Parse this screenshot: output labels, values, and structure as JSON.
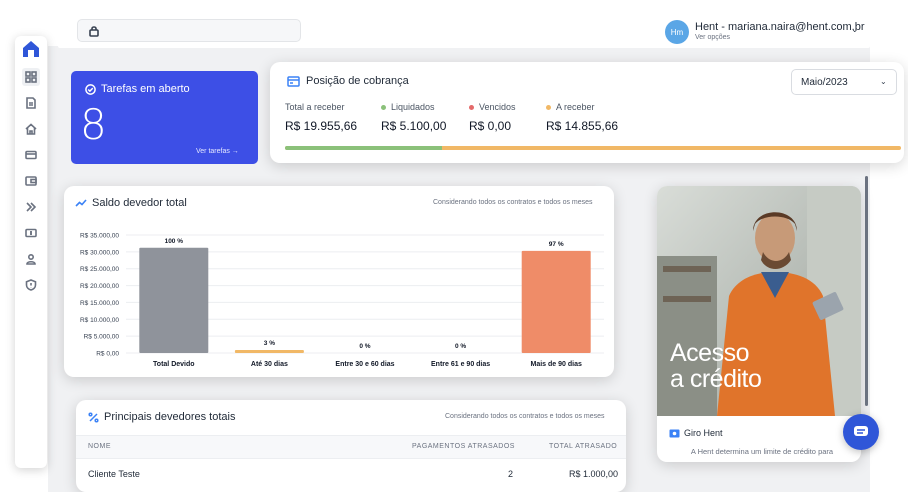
{
  "header": {
    "search_placeholder": "",
    "avatar_initials": "Hm",
    "user_label": "Hent - mariana.naira@hent.com.br",
    "user_sub": "Ver opções"
  },
  "sidebar": {
    "items": [
      "dashboard",
      "document",
      "home",
      "card",
      "wallet",
      "expand",
      "money",
      "user",
      "alert"
    ]
  },
  "tasks": {
    "title": "Tarefas em aberto",
    "count": "8",
    "link": "Ver tarefas →"
  },
  "billing": {
    "title": "Posição de cobrança",
    "month": "Maio/2023",
    "total_label": "Total a receber",
    "total_value": "R$ 19.955,66",
    "paid_label": "Liquidados",
    "paid_value": "R$ 5.100,00",
    "overdue_label": "Vencidos",
    "overdue_value": "R$ 0,00",
    "pending_label": "A receber",
    "pending_value": "R$ 14.855,66",
    "paid_fraction": 0.255,
    "colors": {
      "paid": "#8bc17a",
      "overdue": "#e46a6a",
      "pending": "#f1b866"
    }
  },
  "chart_data": {
    "type": "bar",
    "title": "Saldo devedor total",
    "note": "Considerando todos os contratos e todos os meses",
    "categories": [
      "Total Devido",
      "Até 30 dias",
      "Entre 30 e 60 dias",
      "Entre 61 e 90 dias",
      "Mais de 90 dias"
    ],
    "values": [
      31200,
      900,
      0,
      0,
      30300
    ],
    "value_labels": [
      "100 %",
      "3 %",
      "0 %",
      "0 %",
      "97 %"
    ],
    "colors": [
      "#8f939b",
      "#f1b866",
      "#f1b866",
      "#f1b866",
      "#ef8c68"
    ],
    "yticks": [
      "R$ 35.000,00",
      "R$ 30.000,00",
      "R$ 25.000,00",
      "R$ 20.000,00",
      "R$ 15.000,00",
      "R$ 10.000,00",
      "R$ 5.000,00",
      "R$ 0,00"
    ],
    "ylim": [
      0,
      35000
    ],
    "grid": true
  },
  "debtors": {
    "title": "Principais devedores totais",
    "note": "Considerando todos os contratos e todos os meses",
    "columns": [
      "NOME",
      "PAGAMENTOS ATRASADOS",
      "TOTAL ATRASADO"
    ],
    "rows": [
      {
        "name": "Cliente Teste",
        "late": "2",
        "total": "R$ 1.000,00"
      }
    ]
  },
  "promo": {
    "headline_1": "Acesso",
    "headline_2": "a crédito",
    "brand": "Giro Hent",
    "description": "A Hent determina um limite de crédito para"
  }
}
